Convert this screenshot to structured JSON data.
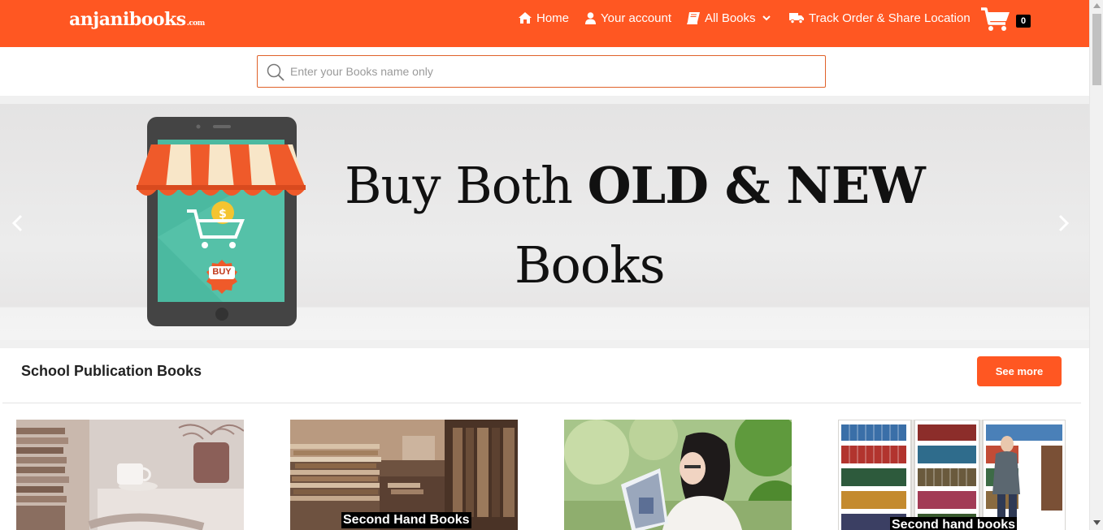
{
  "header": {
    "logo": "anjanibooks",
    "logo_suffix": ".com",
    "nav": [
      {
        "label": "Home",
        "icon": "home-icon"
      },
      {
        "label": "Your account",
        "icon": "user-icon"
      },
      {
        "label": "All Books",
        "icon": "book-icon"
      },
      {
        "label": "Track Order & Share Location",
        "icon": "truck-icon"
      }
    ],
    "cart_count": "0"
  },
  "search": {
    "placeholder": "Enter your Books name only",
    "value": ""
  },
  "banner": {
    "line1_regular": "Buy Both ",
    "line1_bold": "OLD & NEW",
    "line2": "Books",
    "badge": "BUY"
  },
  "section": {
    "title": "School Publication Books",
    "see_more": "See more",
    "cards": [
      {
        "caption": ""
      },
      {
        "caption": "Second Hand Books"
      },
      {
        "caption": ""
      },
      {
        "caption": "Second hand books"
      }
    ]
  },
  "colors": {
    "brand": "#ff5722",
    "banner_bg": "#e8e8e8"
  }
}
